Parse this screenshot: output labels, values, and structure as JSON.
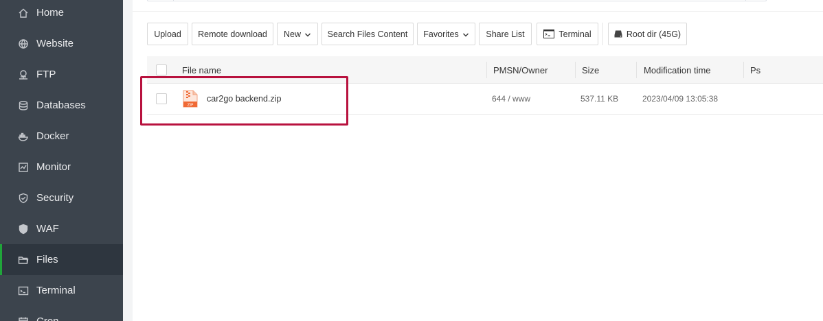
{
  "sidebar": {
    "items": [
      {
        "label": "Home",
        "icon": "home-icon",
        "active": false
      },
      {
        "label": "Website",
        "icon": "globe-icon",
        "active": false
      },
      {
        "label": "FTP",
        "icon": "ftp-icon",
        "active": false
      },
      {
        "label": "Databases",
        "icon": "database-icon",
        "active": false
      },
      {
        "label": "Docker",
        "icon": "docker-icon",
        "active": false
      },
      {
        "label": "Monitor",
        "icon": "monitor-icon",
        "active": false
      },
      {
        "label": "Security",
        "icon": "shield-icon",
        "active": false
      },
      {
        "label": "WAF",
        "icon": "waf-shield-icon",
        "active": false
      },
      {
        "label": "Files",
        "icon": "folder-icon",
        "active": true
      },
      {
        "label": "Terminal",
        "icon": "terminal-icon",
        "active": false
      },
      {
        "label": "Cron",
        "icon": "cron-icon",
        "active": false
      }
    ]
  },
  "toolbar": {
    "upload": "Upload",
    "remote_download": "Remote download",
    "new": "New",
    "search_files_content": "Search Files Content",
    "favorites": "Favorites",
    "share_list": "Share List",
    "terminal": "Terminal",
    "root_dir": "Root dir (45G)"
  },
  "table": {
    "columns": {
      "file_name": "File name",
      "permission_owner": "PMSN/Owner",
      "size": "Size",
      "modification_time": "Modification time",
      "ps": "Ps"
    },
    "rows": [
      {
        "name": "car2go backend.zip",
        "permission_owner": "644 / www",
        "size": "537.11 KB",
        "modified": "2023/04/09 13:05:38",
        "ps": "",
        "file_icon": "zip-file-icon",
        "file_icon_label": "ZIP"
      }
    ]
  },
  "colors": {
    "sidebar_bg": "#3c444d",
    "accent": "#20a53a",
    "highlight": "#b8123e",
    "zip_icon": "#f06a35"
  }
}
